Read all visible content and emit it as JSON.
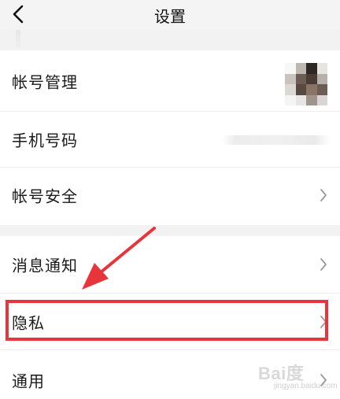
{
  "header": {
    "back_icon": "chevron-left-icon",
    "title": "设置"
  },
  "settings": {
    "account_group": [
      {
        "label": "帐号管理",
        "trailing": "avatar"
      },
      {
        "label": "手机号码",
        "trailing": "masked-phone"
      },
      {
        "label": "帐号安全",
        "trailing": "chevron-right-icon"
      }
    ],
    "general_group": [
      {
        "label": "消息通知",
        "trailing": "chevron-right-icon"
      },
      {
        "label": "隐私",
        "trailing": "chevron-right-icon"
      },
      {
        "label": "通用",
        "trailing": "chevron-right-icon"
      }
    ]
  },
  "annotation": {
    "highlight_color": "#e8343b",
    "arrow_color": "#e8343b",
    "highlighted_item": "隐私"
  },
  "watermark": {
    "text": "Bai度",
    "sub": "jingyan.baidu.com"
  },
  "colors": {
    "page_bg": "#f2f2f2",
    "row_bg": "#ffffff",
    "text": "#1a1a1a",
    "chevron": "#9a9a9a"
  }
}
